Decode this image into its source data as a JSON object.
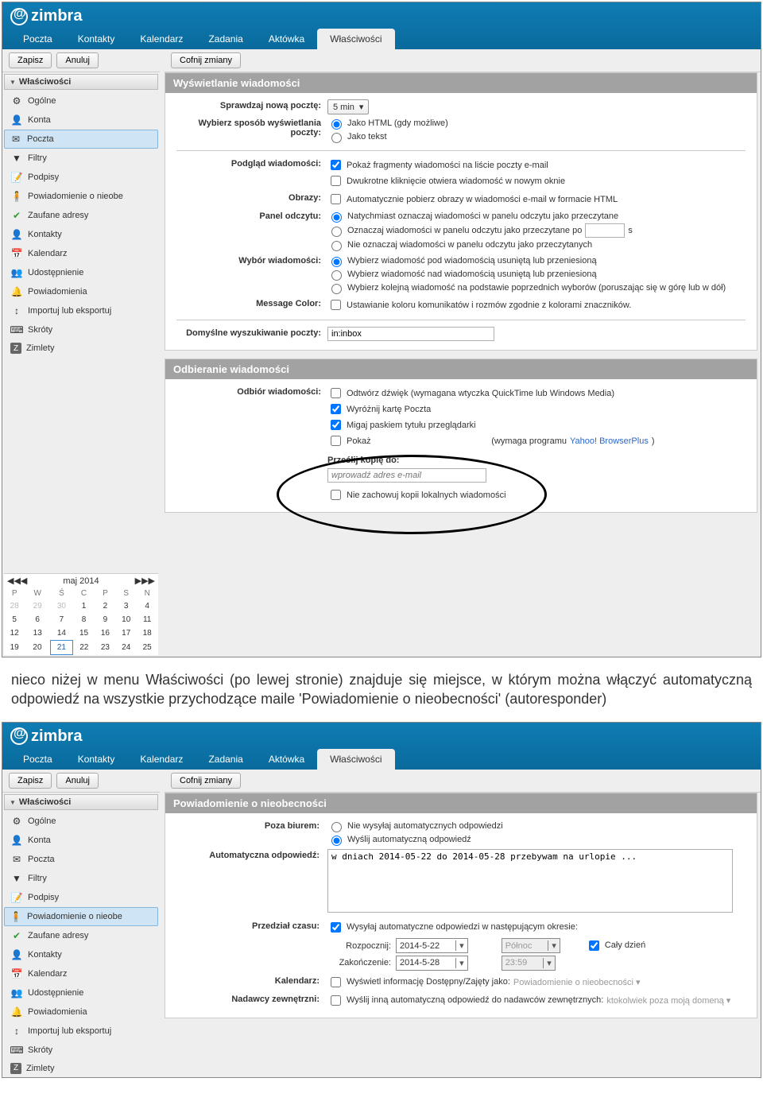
{
  "brand": "zimbra",
  "tabs": [
    "Poczta",
    "Kontakty",
    "Kalendarz",
    "Zadania",
    "Aktówka",
    "Właściwości"
  ],
  "toolbar": {
    "save": "Zapisz",
    "cancel": "Anuluj",
    "undo": "Cofnij zmiany"
  },
  "sidebar": {
    "header": "Właściwości",
    "items": [
      {
        "icon": "⚙",
        "label": "Ogólne"
      },
      {
        "icon": "👤",
        "label": "Konta"
      },
      {
        "icon": "✉",
        "label": "Poczta"
      },
      {
        "icon": "▼",
        "label": "Filtry"
      },
      {
        "icon": "📝",
        "label": "Podpisy"
      },
      {
        "icon": "🧍",
        "label": "Powiadomienie o nieobe"
      },
      {
        "icon": "✔",
        "label": "Zaufane adresy"
      },
      {
        "icon": "👤",
        "label": "Kontakty"
      },
      {
        "icon": "📅",
        "label": "Kalendarz"
      },
      {
        "icon": "👥",
        "label": "Udostępnienie"
      },
      {
        "icon": "🔔",
        "label": "Powiadomienia"
      },
      {
        "icon": "↕",
        "label": "Importuj lub eksportuj"
      },
      {
        "icon": "⌨",
        "label": "Skróty"
      },
      {
        "icon": "Z",
        "label": "Zimlety"
      }
    ]
  },
  "panel1": {
    "title": "Wyświetlanie wiadomości",
    "check_interval_label": "Sprawdzaj nową pocztę:",
    "check_interval_value": "5 min",
    "display_mode_label": "Wybierz sposób wyświetlania poczty:",
    "display_html": "Jako HTML (gdy możliwe)",
    "display_text": "Jako tekst",
    "preview_label": "Podgląd wiadomości:",
    "preview_snippets": "Pokaż fragmenty wiadomości na liście poczty e-mail",
    "preview_dblclick": "Dwukrotne kliknięcie otwiera wiadomość w nowym oknie",
    "images_label": "Obrazy:",
    "images_auto": "Automatycznie pobierz obrazy w wiadomości e-mail w formacie HTML",
    "reading_label": "Panel odczytu:",
    "reading_immediate": "Natychmiast oznaczaj wiadomości w panelu odczytu jako przeczytane",
    "reading_after_prefix": "Oznaczaj wiadomości w panelu odczytu jako przeczytane po",
    "reading_after_suffix": "s",
    "reading_never": "Nie oznaczaj wiadomości w panelu odczytu jako przeczytanych",
    "select_label": "Wybór wiadomości:",
    "select_below": "Wybierz wiadomość pod wiadomością usuniętą lub przeniesioną",
    "select_above": "Wybierz wiadomość nad wiadomością usuniętą lub przeniesioną",
    "select_prev": "Wybierz kolejną wiadomość na podstawie poprzednich wyborów (poruszając się w górę lub w dół)",
    "msgcolor_label": "Message Color:",
    "msgcolor_opt": "Ustawianie koloru komunikatów i rozmów zgodnie z kolorami znaczników.",
    "default_search_label": "Domyślne wyszukiwanie poczty:",
    "default_search_value": "in:inbox"
  },
  "panel2": {
    "title": "Odbieranie wiadomości",
    "receive_label": "Odbiór wiadomości:",
    "play_sound": "Odtwórz dźwięk (wymagana wtyczka QuickTime lub Windows Media)",
    "highlight_tab": "Wyróżnij kartę Poczta",
    "flash_title": "Migaj paskiem tytułu przeglądarki",
    "popup_prefix": "Pokaż",
    "popup_mid": "(wymaga programu ",
    "popup_link": "Yahoo! BrowserPlus",
    "popup_suffix": ")",
    "forward_label": "Prześlij kopię do:",
    "forward_placeholder": "wprowadź adres e-mail",
    "no_local_copy": "Nie zachowuj kopii lokalnych wiadomości"
  },
  "calendar": {
    "title": "maj 2014",
    "days": [
      "P",
      "W",
      "Ś",
      "C",
      "P",
      "S",
      "N"
    ],
    "rows": [
      [
        "28",
        "29",
        "30",
        "1",
        "2",
        "3",
        "4"
      ],
      [
        "5",
        "6",
        "7",
        "8",
        "9",
        "10",
        "11"
      ],
      [
        "12",
        "13",
        "14",
        "15",
        "16",
        "17",
        "18"
      ],
      [
        "19",
        "20",
        "21",
        "22",
        "23",
        "24",
        "25"
      ]
    ],
    "today": "21"
  },
  "body_paragraph": "nieco niżej w menu Właściwości (po lewej stronie) znajduje się miejsce, w którym można włączyć automatyczną odpowiedź na wszystkie przychodzące maile 'Powiadomienie o nieobecności' (autoresponder)",
  "ooo": {
    "panel_title": "Powiadomienie o nieobecności",
    "away_label": "Poza biurem:",
    "away_no": "Nie wysyłaj automatycznych odpowiedzi",
    "away_yes": "Wyślij automatyczną odpowiedź",
    "reply_label": "Automatyczna odpowiedź:",
    "reply_text": "w dniach 2014-05-22 do 2014-05-28 przebywam na urlopie ...",
    "period_label": "Przedział czasu:",
    "period_send": "Wysyłaj automatyczne odpowiedzi w następującym okresie:",
    "start_label": "Rozpocznij:",
    "start_date": "2014-5-22",
    "start_time": "Północ",
    "allday": "Cały dzień",
    "end_label": "Zakończenie:",
    "end_date": "2014-5-28",
    "end_time": "23:59",
    "cal_label": "Kalendarz:",
    "cal_opt": "Wyświetl informację Dostępny/Zajęty jako:",
    "cal_value": "Powiadomienie o nieobecności ▾",
    "ext_label": "Nadawcy zewnętrzni:",
    "ext_opt": "Wyślij inną automatyczną odpowiedź do nadawców zewnętrznych:",
    "ext_value": "ktokolwiek poza moją domeną ▾"
  }
}
